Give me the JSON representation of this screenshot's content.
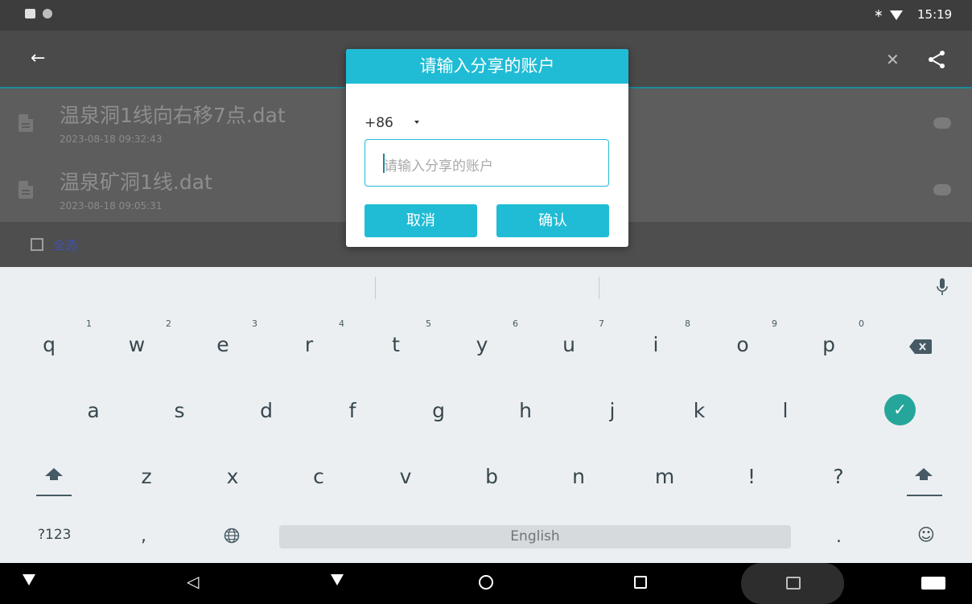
{
  "status_bar": {
    "time": "15:19",
    "icons": [
      "image-icon",
      "dot-icon",
      "bluetooth-icon",
      "wifi-icon"
    ]
  },
  "toolbar": {
    "back_icon": "arrow-left-icon",
    "close_icon": "close-icon",
    "share_icon": "share-icon"
  },
  "files": [
    {
      "name": "温泉洞1线向右移7点.dat",
      "date": "2023-08-18 09:32:43"
    },
    {
      "name": "温泉矿洞1线.dat",
      "date": "2023-08-18 09:05:31"
    }
  ],
  "footer": {
    "select_all": "全选"
  },
  "dialog": {
    "title": "请输入分享的账户",
    "country_code": "+86",
    "account_placeholder": "请输入分享的账户",
    "cancel": "取消",
    "confirm": "确认"
  },
  "keyboard": {
    "row1": [
      "q",
      "w",
      "e",
      "r",
      "t",
      "y",
      "u",
      "i",
      "o",
      "p"
    ],
    "row1_hints": [
      "1",
      "2",
      "3",
      "4",
      "5",
      "6",
      "7",
      "8",
      "9",
      "0"
    ],
    "row2": [
      "a",
      "s",
      "d",
      "f",
      "g",
      "h",
      "j",
      "k",
      "l"
    ],
    "row3": [
      "z",
      "x",
      "c",
      "v",
      "b",
      "n",
      "m",
      "!",
      "?"
    ],
    "symbols": "?123",
    "comma": ",",
    "space": "English",
    "period": ".",
    "accent": "#26a69a"
  },
  "colors": {
    "accent": "#20bcd5"
  }
}
